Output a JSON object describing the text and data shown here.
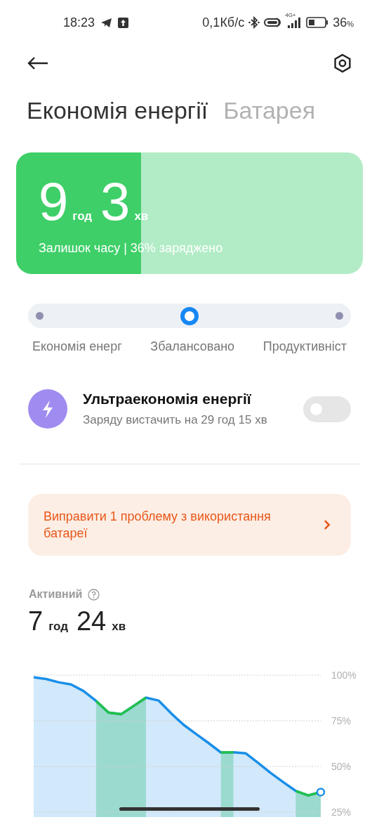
{
  "status_bar": {
    "time": "18:23",
    "speed": "0,1Кб/с",
    "network": "4G+",
    "battery_percent": "36",
    "battery_unit": "%"
  },
  "tabs": [
    {
      "label": "Економія енергії",
      "selected": true
    },
    {
      "label": "Батарея",
      "selected": false
    }
  ],
  "remaining_card": {
    "hours": "9",
    "hours_unit": "год",
    "minutes": "3",
    "minutes_unit": "хв",
    "caption": "Залишок часу | 36% заряджено",
    "level": 0.36
  },
  "modes": [
    {
      "label": "Економія енерг",
      "selected": false
    },
    {
      "label": "Збалансовано",
      "selected": true
    },
    {
      "label": "Продуктивніст",
      "selected": false
    }
  ],
  "ultra_saver": {
    "title": "Ультраекономія енергії",
    "subtitle": "Заряду вистачить на 29 год 15 хв",
    "on": false
  },
  "issue_banner": {
    "text": "Виправити 1 проблему з використання батареї"
  },
  "active": {
    "label": "Активний",
    "hours": "7",
    "hours_unit": "год",
    "minutes": "24",
    "minutes_unit": "хв"
  },
  "chart_data": {
    "type": "area",
    "grid": true,
    "categories": [
      null,
      null,
      null,
      null,
      null,
      null,
      null,
      null,
      null,
      null,
      null,
      null,
      null,
      null,
      null,
      null,
      null,
      null,
      null,
      null,
      null,
      null,
      null,
      null
    ],
    "ylim": [
      25,
      100
    ],
    "yticks": [
      {
        "value": 100,
        "label": "100%"
      },
      {
        "value": 75,
        "label": "75%"
      },
      {
        "value": 50,
        "label": "50%"
      },
      {
        "value": 25,
        "label": "25%"
      }
    ],
    "series": [
      {
        "color": "#1a8fe8",
        "values": [
          98.8,
          97.9,
          96.1,
          94.9,
          91.3,
          85.9,
          79.5,
          78.6,
          83.1,
          87.7,
          86.1,
          79.2,
          72.9,
          67.8,
          62.9,
          57.7,
          57.8,
          57.2,
          51.9,
          46.4,
          41.4,
          36.6,
          34.2,
          36
        ]
      },
      {
        "color": "#22c24a",
        "values": [
          null,
          null,
          null,
          null,
          null,
          85.9,
          79.5,
          78.6,
          83.1,
          87.7,
          null,
          null,
          null,
          null,
          null,
          57.7,
          57.8,
          null,
          null,
          null,
          null,
          36.6,
          34.2,
          36
        ]
      }
    ]
  }
}
